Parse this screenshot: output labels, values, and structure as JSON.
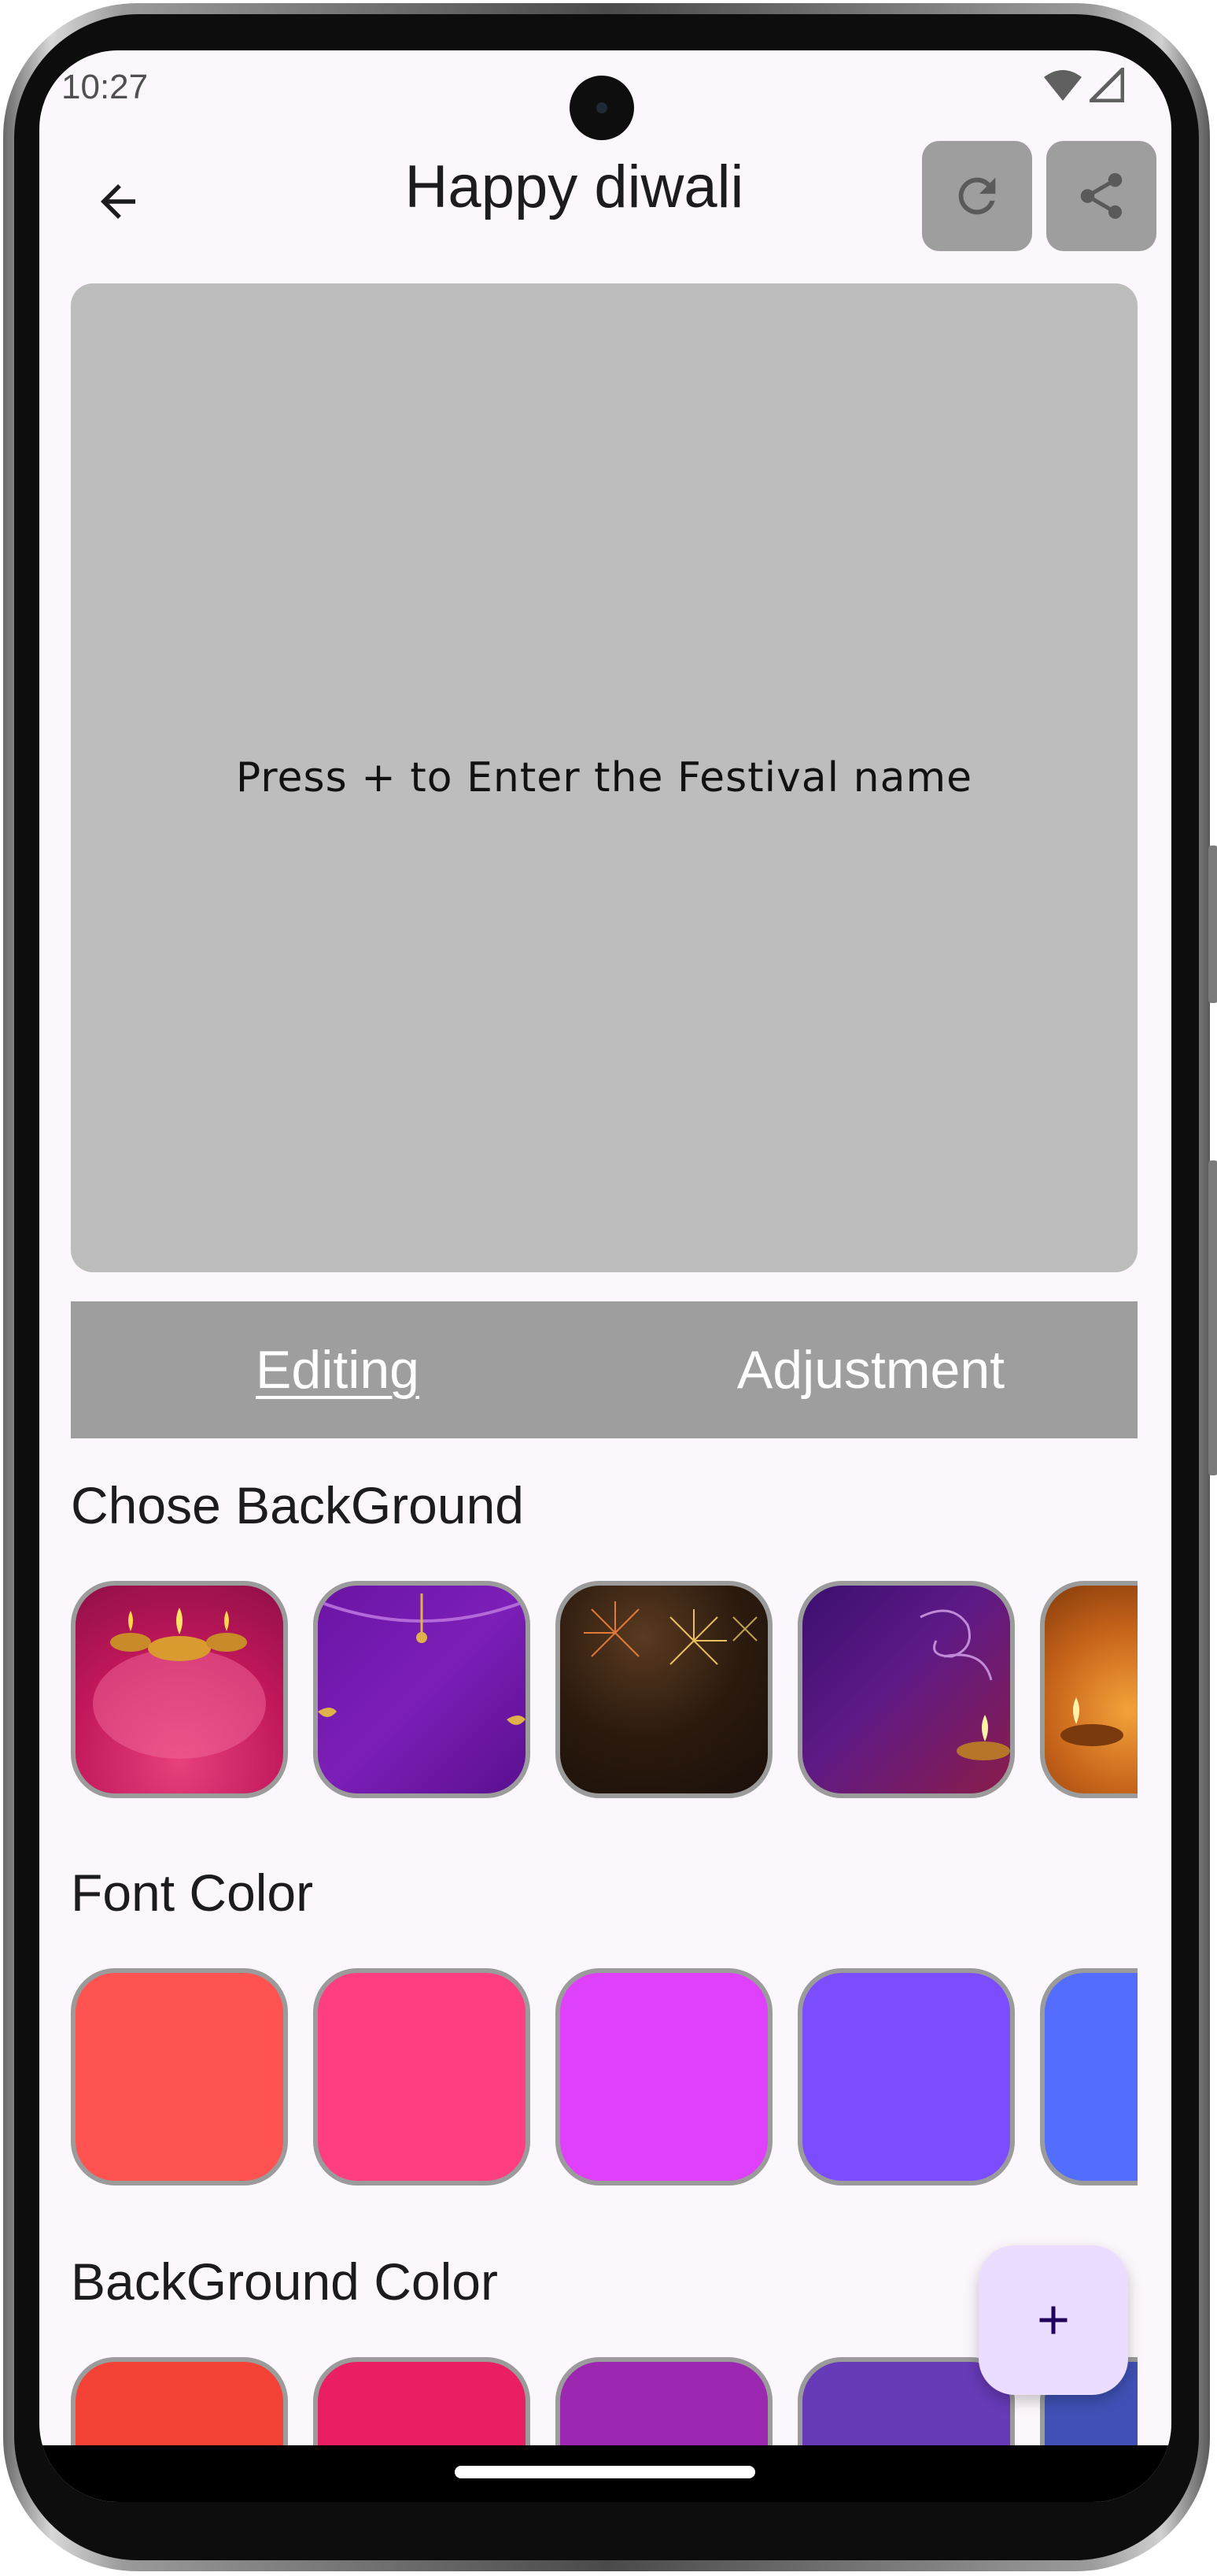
{
  "status_bar": {
    "time": "10:27"
  },
  "app_bar": {
    "title": "Happy diwali"
  },
  "preview": {
    "placeholder": "Press + to Enter the Festival name"
  },
  "tabs": [
    {
      "label": "Editing",
      "active": true
    },
    {
      "label": "Adjustment",
      "active": false
    }
  ],
  "sections": {
    "background": {
      "title": "Chose BackGround"
    },
    "font_color": {
      "title": "Font Color",
      "colors": [
        "#fe5350",
        "#fe3e80",
        "#df40fb",
        "#7c4dff",
        "#536dfe"
      ]
    },
    "background_color": {
      "title": "BackGround Color",
      "colors": [
        "#f44336",
        "#e91e63",
        "#9c27b0",
        "#673ab7",
        "#3f51b5"
      ]
    }
  },
  "icons": {
    "back": "arrow-left-icon",
    "refresh": "refresh-icon",
    "share": "share-icon",
    "fab": "plus-icon"
  }
}
